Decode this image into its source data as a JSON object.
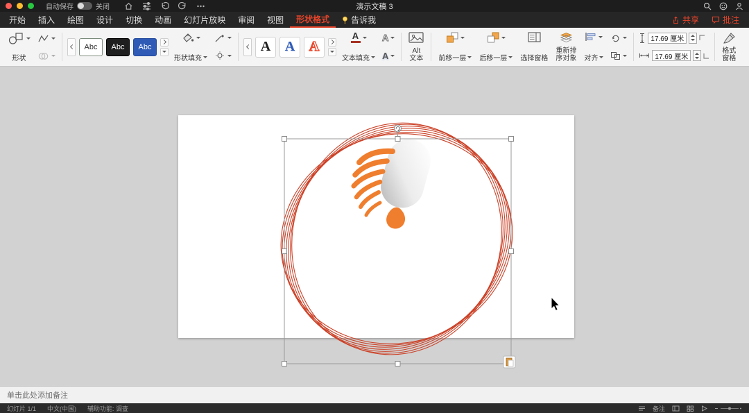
{
  "colors": {
    "accent_red": "#e8442a",
    "swatch_blue": "#2f5bb7",
    "artwork_stroke": "#cc4329",
    "artwork_orange": "#ef7e2e"
  },
  "titlebar": {
    "autosave_label": "自动保存",
    "autosave_state": "关闭",
    "title": "演示文稿 3"
  },
  "tabbar": {
    "tabs": [
      {
        "label": "开始"
      },
      {
        "label": "插入"
      },
      {
        "label": "绘图"
      },
      {
        "label": "设计"
      },
      {
        "label": "切换"
      },
      {
        "label": "动画"
      },
      {
        "label": "幻灯片放映"
      },
      {
        "label": "审阅"
      },
      {
        "label": "视图"
      },
      {
        "label": "形状格式"
      },
      {
        "label": "告诉我"
      }
    ],
    "active_tab": "形状格式",
    "share_label": "共享",
    "comments_label": "批注"
  },
  "ribbon": {
    "shapes_label": "形状",
    "style_gallery": {
      "swatches": [
        "Abc",
        "Abc",
        "Abc"
      ]
    },
    "shape_fill_label": "形状填充",
    "wordart_gallery": {
      "letters": [
        "A",
        "A",
        "A"
      ]
    },
    "text_fill_label": "文本填充",
    "alt_text_line1": "Alt",
    "alt_text_line2": "文本",
    "arrange": {
      "bring_forward": "前移一层",
      "send_backward": "后移一层",
      "selection_pane": "选择窗格",
      "reorder_line1": "重新排",
      "reorder_line2": "序对象",
      "align": "对齐"
    },
    "size": {
      "height_value": "17.69 厘米",
      "width_value": "17.69 厘米"
    },
    "format_pane_line1": "格式",
    "format_pane_line2": "窗格"
  },
  "notes": {
    "placeholder": "单击此处添加备注"
  },
  "statusbar": {
    "slide_info": "幻灯片 1/1",
    "language": "中文(中国)",
    "accessibility": "辅助功能: 调查",
    "notes_label": "备注"
  }
}
